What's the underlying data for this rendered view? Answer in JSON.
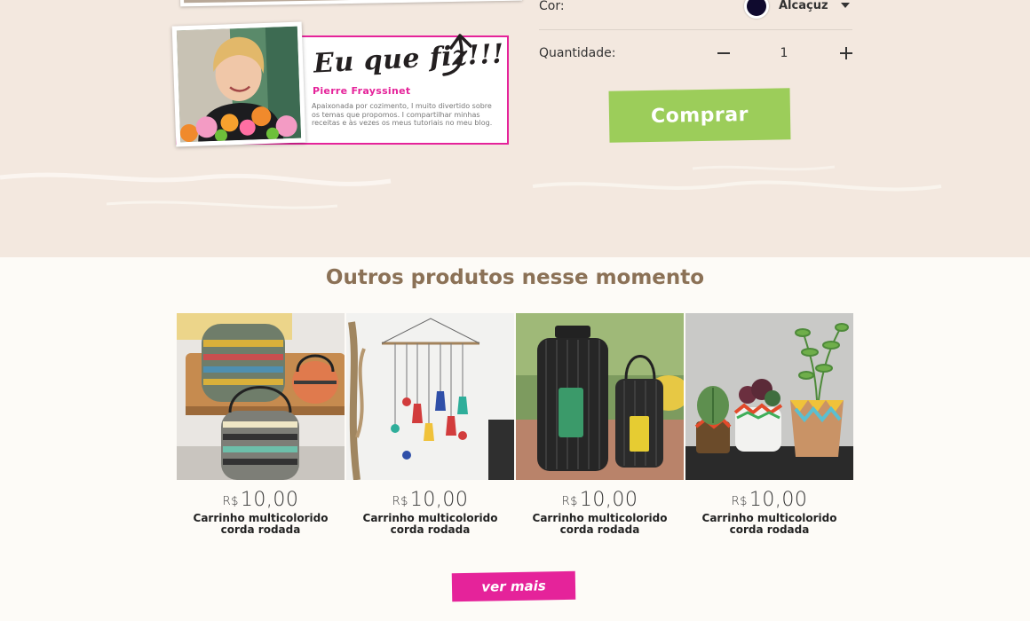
{
  "author": {
    "heading": "Eu que fiz!!!",
    "name": "Pierre Frayssinet",
    "bio": "Apaixonada por cozimento, I muito divertido sobre os temas que propomos. I compartilhar minhas receitas e às vezes os meus tutoriais no meu blog."
  },
  "options": {
    "color_label": "Cor:",
    "color_value": "Alcaçuz",
    "color_hex": "#0f0a2e",
    "quantity_label": "Quantidade:",
    "quantity_value": "1"
  },
  "buy_label": "Comprar",
  "section_title": "Outros produtos nesse momento",
  "products": [
    {
      "currency": "R$",
      "price": "10,00",
      "name": "Carrinho multicolorido corda rodada"
    },
    {
      "currency": "R$",
      "price": "10,00",
      "name": "Carrinho multicolorido corda rodada"
    },
    {
      "currency": "R$",
      "price": "10,00",
      "name": "Carrinho multicolorido corda rodada"
    },
    {
      "currency": "R$",
      "price": "10,00",
      "name": "Carrinho multicolorido corda rodada"
    }
  ],
  "more_label": "ver mais",
  "colors": {
    "accent_pink": "#e5239a",
    "buy_green": "#9ccd5a",
    "title_brown": "#8b7156",
    "band_beige": "#f3e8df"
  }
}
